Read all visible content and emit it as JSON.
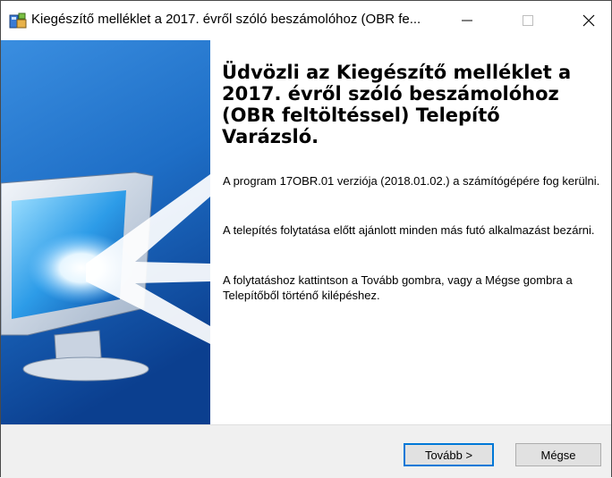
{
  "window": {
    "title": "Kiegészítő melléklet a 2017. évről szóló beszámolóhoz (OBR fe..."
  },
  "welcome": {
    "heading": "Üdvözli az Kiegészítő melléklet a 2017. évről szóló beszámolóhoz (OBR feltöltéssel) Telepítő Varázsló.",
    "paragraph1": "A program 17OBR.01 verziója (2018.01.02.) a számítógépére fog kerülni.",
    "paragraph2": "A telepítés folytatása előtt ajánlott minden más futó alkalmazást bezárni.",
    "paragraph3": "A folytatáshoz kattintson a Tovább gombra, vagy a Mégse gombra a Telepítőből történő kilépéshez."
  },
  "buttons": {
    "next_label": "Tovább >",
    "cancel_label": "Mégse"
  },
  "colors": {
    "sidebar_top": "#1e6ec6",
    "sidebar_bottom": "#0b3f8f",
    "focus_border": "#0078d7"
  }
}
